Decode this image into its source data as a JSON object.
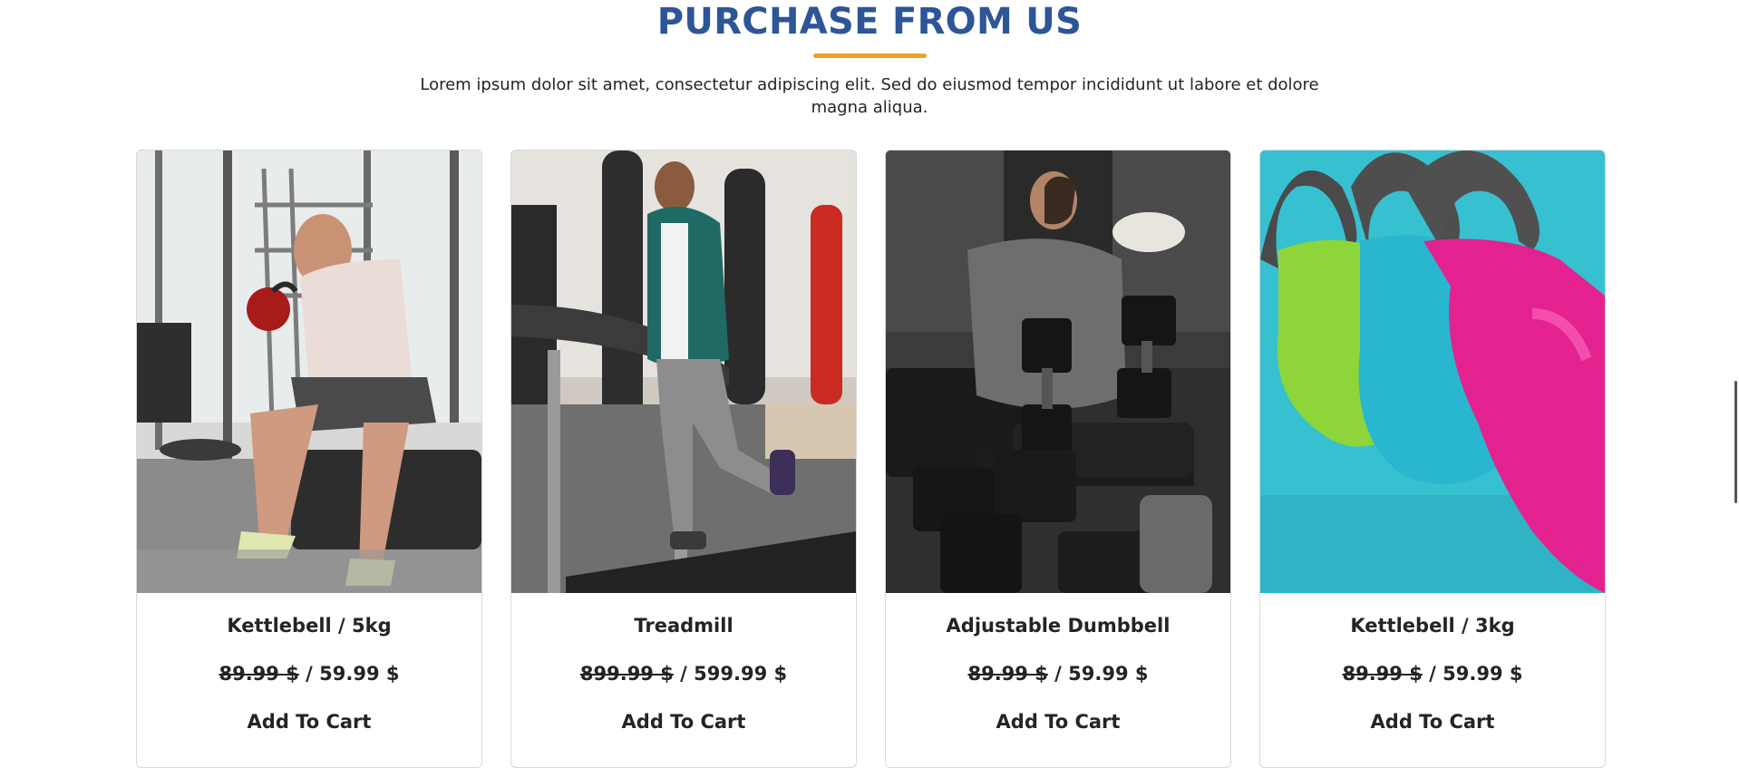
{
  "section": {
    "title": "PURCHASE FROM US",
    "subtitle": "Lorem ipsum dolor sit amet, consectetur adipiscing elit. Sed do eiusmod tempor incididunt ut labore et dolore magna aliqua."
  },
  "colors": {
    "title": "#2e5597",
    "accent": "#f0a125"
  },
  "products": [
    {
      "name": "Kettlebell / 5kg",
      "old_price": "89.99 $",
      "separator": "/",
      "new_price": "59.99 $",
      "cta": "Add To Cart",
      "image": "man-with-kettlebell-photo"
    },
    {
      "name": "Treadmill",
      "old_price": "899.99 $",
      "separator": "/",
      "new_price": "599.99 $",
      "cta": "Add To Cart",
      "image": "man-running-treadmill-photo"
    },
    {
      "name": "Adjustable Dumbbell",
      "old_price": "89.99 $",
      "separator": "/",
      "new_price": "59.99 $",
      "cta": "Add To Cart",
      "image": "man-with-dumbbells-photo"
    },
    {
      "name": "Kettlebell / 3kg",
      "old_price": "89.99 $",
      "separator": "/",
      "new_price": "59.99 $",
      "cta": "Add To Cart",
      "image": "colorful-kettlebells-photo"
    }
  ]
}
